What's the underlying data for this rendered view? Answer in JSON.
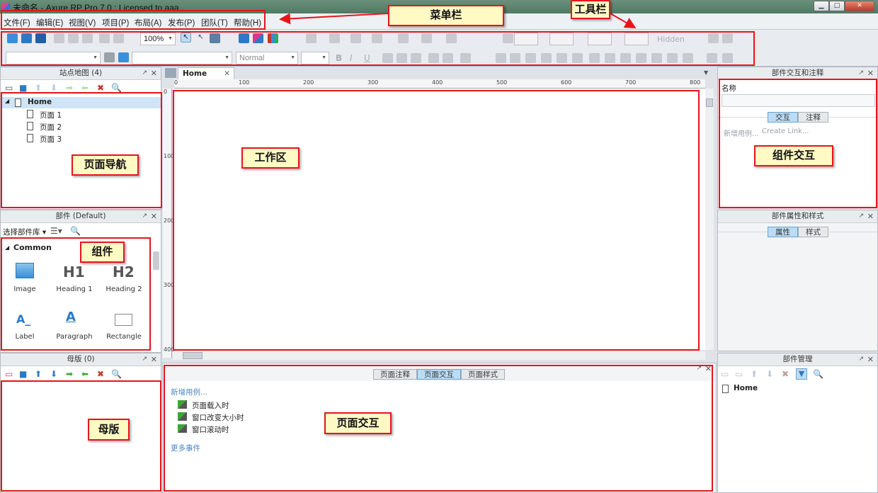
{
  "window": {
    "title": "未命名 - Axure RP Pro 7.0 : Licensed to aaa",
    "min": "▁",
    "max": "□",
    "close": "✕"
  },
  "menu": [
    "文件(F)",
    "编辑(E)",
    "视图(V)",
    "项目(P)",
    "布局(A)",
    "发布(P)",
    "团队(T)",
    "帮助(H)"
  ],
  "toolbar": {
    "zoom": "100%",
    "style": "Normal",
    "hidden_label": "Hidden"
  },
  "annotations": {
    "menubar": "菜单栏",
    "toolbar": "工具栏",
    "page_nav": "页面导航",
    "workspace": "工作区",
    "widget_inter": "组件交互",
    "widgets": "组件",
    "master": "母版",
    "page_inter": "页面交互"
  },
  "sitemap": {
    "title": "站点地图 (4)",
    "home": "Home",
    "pages": [
      "页面 1",
      "页面 2",
      "页面 3"
    ]
  },
  "widgets": {
    "title": "部件 (Default)",
    "library_select": "选择部件库",
    "category": "Common",
    "items": [
      {
        "label": "Image",
        "icon": "image-icon"
      },
      {
        "label": "Heading 1",
        "glyph": "H1"
      },
      {
        "label": "Heading 2",
        "glyph": "H2"
      },
      {
        "label": "Label",
        "glyph": "A_"
      },
      {
        "label": "Paragraph",
        "glyph": "A"
      },
      {
        "label": "Rectangle",
        "icon": "rectangle-icon"
      }
    ]
  },
  "masters": {
    "title": "母版 (0)"
  },
  "canvas": {
    "tab": "Home",
    "ruler_h": [
      "0",
      "100",
      "200",
      "300",
      "400",
      "500",
      "600",
      "700",
      "800"
    ],
    "ruler_v": [
      "0",
      "100",
      "200",
      "300",
      "400"
    ]
  },
  "page_props": {
    "tabs": [
      "页面注释",
      "页面交互",
      "页面样式"
    ],
    "active": 1,
    "add_case": "新增用例...",
    "events": [
      "页面载入时",
      "窗口改变大小时",
      "窗口滚动时"
    ],
    "more": "更多事件"
  },
  "widget_inter": {
    "title": "部件交互和注释",
    "name_label": "名称",
    "tabs": [
      "交互",
      "注释"
    ],
    "add_case": "新增用例...",
    "create_link": "Create Link..."
  },
  "widget_props": {
    "title": "部件属性和样式",
    "tabs": [
      "属性",
      "样式"
    ]
  },
  "widget_mgr": {
    "title": "部件管理",
    "home": "Home"
  }
}
